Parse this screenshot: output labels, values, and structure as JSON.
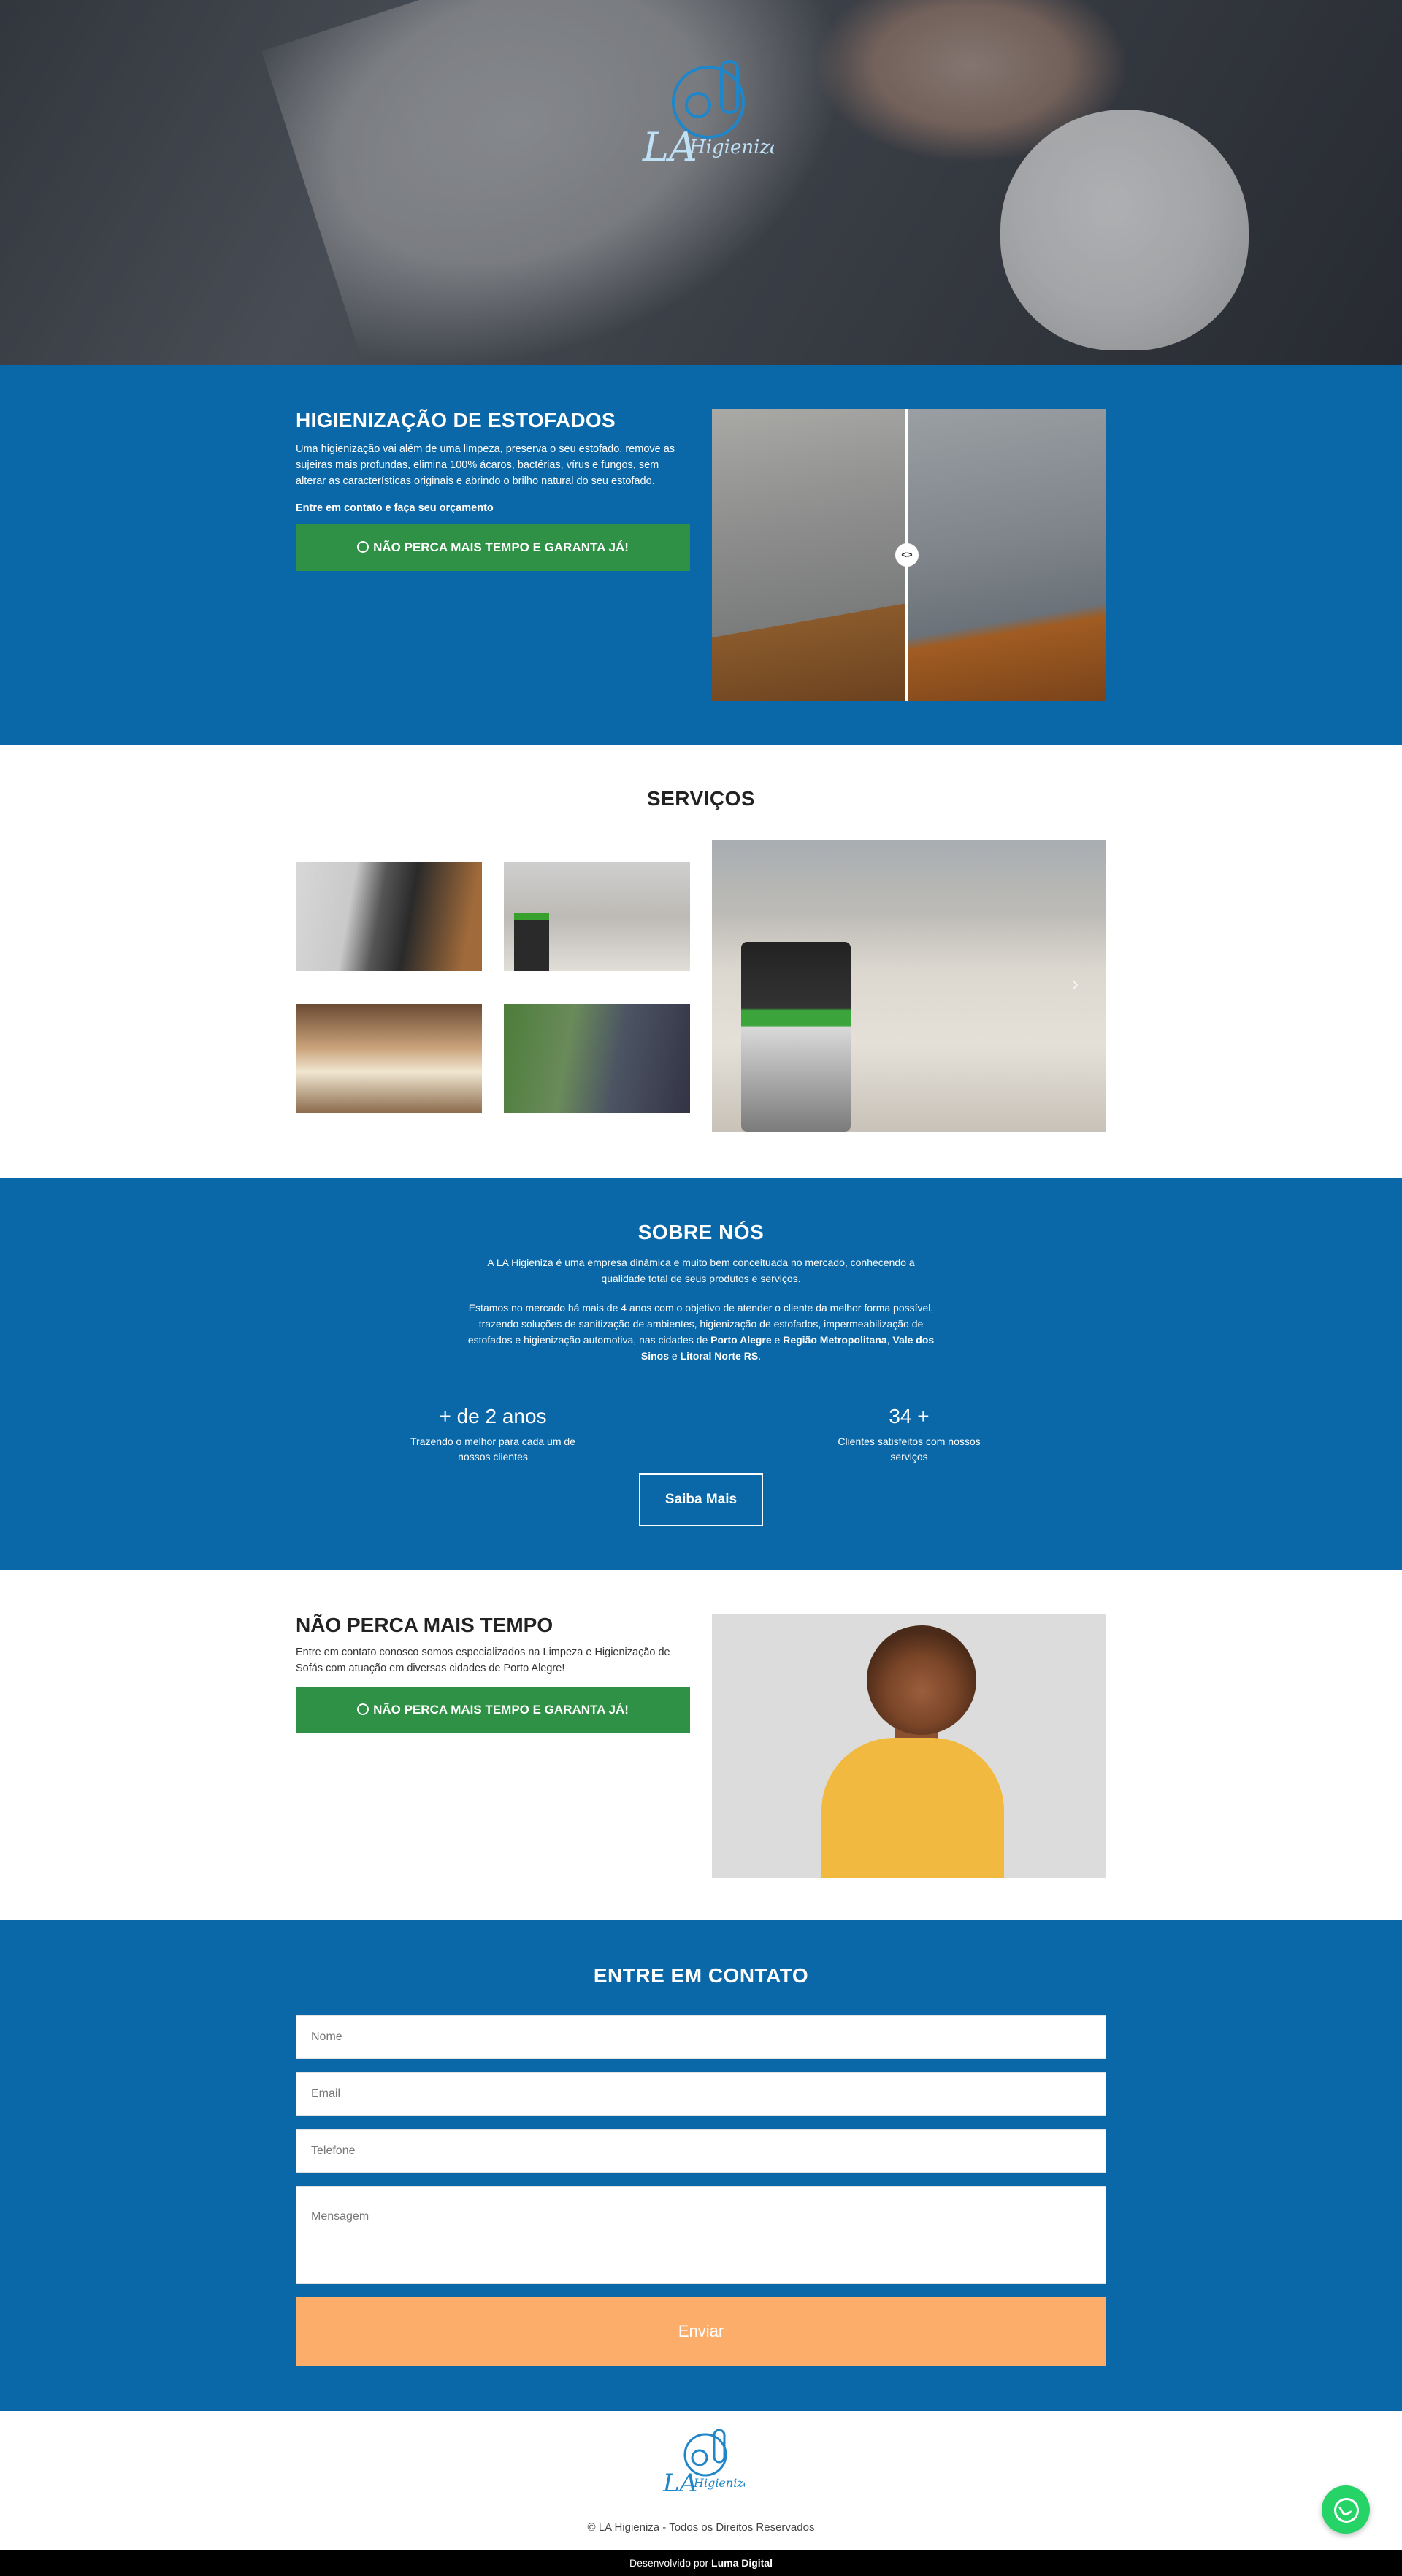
{
  "brand": {
    "logo_text": "LA Higieniza",
    "logo_icon": "vacuum-logo-icon"
  },
  "hero": {
    "background": "hero-cleaning-photo"
  },
  "upholstery": {
    "title": "HIGIENIZAÇÃO DE ESTOFADOS",
    "description": "Uma higienização vai além de uma limpeza, preserva o seu estofado, remove as sujeiras mais profundas, elimina 100% ácaros, bactérias, vírus e fungos, sem alterar as características originais e abrindo o brilho natural do seu estofado.",
    "cta_text": "Entre em contato e faça seu orçamento",
    "button_label": "NÃO PERCA MAIS TEMPO E GARANTA JÁ!",
    "compare_handle": "<>"
  },
  "services": {
    "title": "SERVIÇOS",
    "slider_next": "›"
  },
  "about": {
    "title": "SOBRE NÓS",
    "p1": "A LA Higieniza é uma empresa dinâmica e muito bem conceituada no mercado, conhecendo a qualidade total de seus produtos e serviços.",
    "p2_start": "Estamos no mercado há mais de 4 anos com o objetivo de atender o cliente da melhor forma possível, trazendo soluções de sanitização de ambientes, higienização de estofados, impermeabilização de estofados e higienização automotiva, nas cidades de ",
    "city1": "Porto Alegre",
    "sep1": " e ",
    "city2": "Região Metropolitana",
    "sep2": ", ",
    "city3": "Vale dos Sinos",
    "sep3": " e ",
    "city4": "Litoral Norte RS",
    "end": ".",
    "stats": [
      {
        "value": "+ de 2 anos",
        "label": "Trazendo o melhor para cada um de nossos clientes"
      },
      {
        "value": "34 +",
        "label": "Clientes satisfeitos com nossos serviços"
      }
    ],
    "button_label": "Saiba Mais"
  },
  "promo": {
    "title": "NÃO PERCA MAIS TEMPO",
    "text": "Entre em contato conosco somos especializados na Limpeza e Higienização de Sofás com atuação em diversas cidades de Porto Alegre!",
    "button_label": "NÃO PERCA MAIS TEMPO E GARANTA JÁ!"
  },
  "contact": {
    "title": "ENTRE EM CONTATO",
    "name_placeholder": "Nome",
    "email_placeholder": "Email",
    "phone_placeholder": "Telefone",
    "message_placeholder": "Mensagem",
    "submit_label": "Enviar"
  },
  "footer": {
    "copyright": "© LA Higieniza - Todos os Direitos Reservados",
    "dev_prefix": "Desenvolvido por ",
    "dev_name": "Luma Digital"
  },
  "colors": {
    "primary_blue": "#0a68a8",
    "green_button": "#2f9145",
    "send_button": "#fdad6a",
    "whatsapp": "#25d366"
  }
}
